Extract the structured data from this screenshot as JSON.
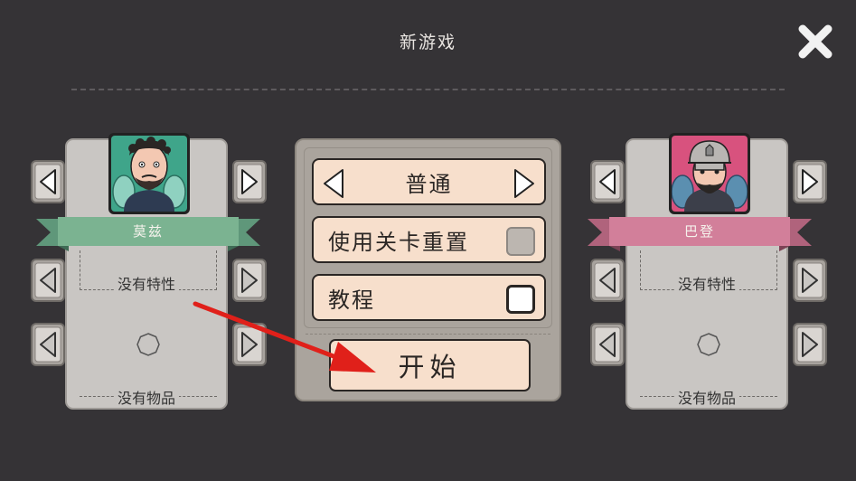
{
  "screen": {
    "title": "新游戏"
  },
  "left_character": {
    "name": "莫兹",
    "trait": "没有特性",
    "item": "没有物品",
    "banner_color": "#7bb391"
  },
  "right_character": {
    "name": "巴登",
    "trait": "没有特性",
    "item": "没有物品",
    "banner_color": "#d27f9a"
  },
  "options": {
    "difficulty": "普通",
    "level_reset_label": "使用关卡重置",
    "level_reset_enabled": false,
    "tutorial_label": "教程",
    "tutorial_enabled": true
  },
  "start_label": "开始",
  "colors": {
    "background": "#353336",
    "option_fill": "#f7dfcc",
    "annotation_arrow": "#e0201a"
  }
}
